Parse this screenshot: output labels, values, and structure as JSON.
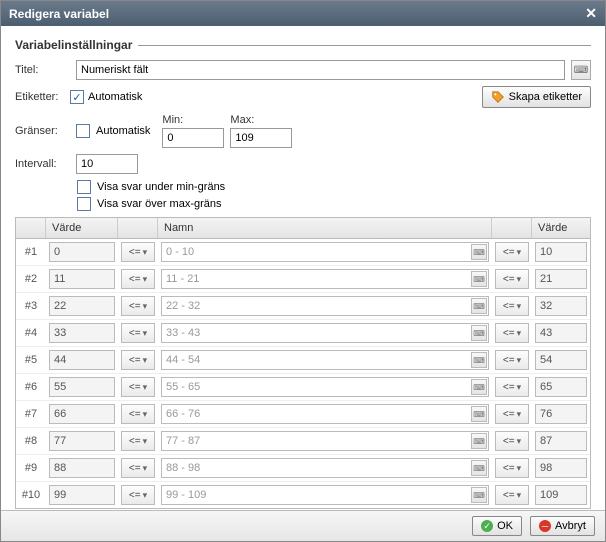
{
  "titlebar": {
    "title": "Redigera variabel"
  },
  "section": {
    "heading": "Variabelinställningar"
  },
  "labels": {
    "title": "Titel:",
    "etiketter": "Etiketter:",
    "automatisk": "Automatisk",
    "granser": "Gränser:",
    "min": "Min:",
    "max": "Max:",
    "intervall": "Intervall:",
    "showBelow": "Visa svar under min-gräns",
    "showAbove": "Visa svar över max-gräns",
    "createLabels": "Skapa etiketter"
  },
  "values": {
    "title": "Numeriskt fält",
    "min": "0",
    "max": "109",
    "intervall": "10",
    "etiketterAuto": true,
    "granserAuto": false,
    "showBelow": false,
    "showAbove": false
  },
  "grid": {
    "headers": {
      "varde": "Värde",
      "namn": "Namn",
      "varde2": "Värde"
    },
    "op": "<=",
    "rows": [
      {
        "idx": "#1",
        "v1": "0",
        "name": "0 - 10",
        "v2": "10"
      },
      {
        "idx": "#2",
        "v1": "11",
        "name": "11 - 21",
        "v2": "21"
      },
      {
        "idx": "#3",
        "v1": "22",
        "name": "22 - 32",
        "v2": "32"
      },
      {
        "idx": "#4",
        "v1": "33",
        "name": "33 - 43",
        "v2": "43"
      },
      {
        "idx": "#5",
        "v1": "44",
        "name": "44 - 54",
        "v2": "54"
      },
      {
        "idx": "#6",
        "v1": "55",
        "name": "55 - 65",
        "v2": "65"
      },
      {
        "idx": "#7",
        "v1": "66",
        "name": "66 - 76",
        "v2": "76"
      },
      {
        "idx": "#8",
        "v1": "77",
        "name": "77 - 87",
        "v2": "87"
      },
      {
        "idx": "#9",
        "v1": "88",
        "name": "88 - 98",
        "v2": "98"
      },
      {
        "idx": "#10",
        "v1": "99",
        "name": "99 - 109",
        "v2": "109"
      }
    ]
  },
  "footer": {
    "ok": "OK",
    "cancel": "Avbryt"
  }
}
